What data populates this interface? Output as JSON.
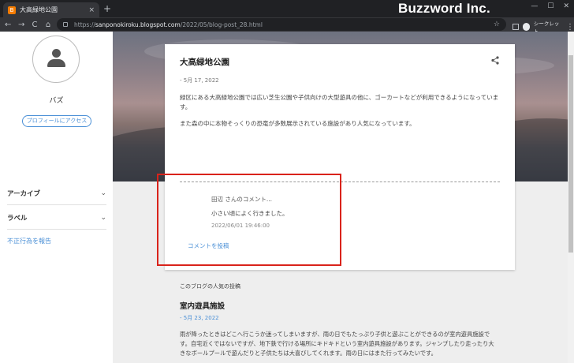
{
  "browser": {
    "tab_title": "大高緑地公園",
    "favicon_letter": "B",
    "tab_close": "×",
    "new_tab": "+",
    "brand": "Buzzword Inc.",
    "win_min": "—",
    "win_max": "☐",
    "win_close": "✕",
    "back": "←",
    "forward": "→",
    "reload": "C",
    "home": "⌂",
    "url_scheme": "https://",
    "url_host": "sanponokiroku.blogspot.com",
    "url_path": "/2022/05/blog-post_28.html",
    "star": "☆",
    "incognito_label": "シークレット",
    "menu": "⋮"
  },
  "sidebar": {
    "profile_name": "バズ",
    "profile_button": "プロフィールにアクセス",
    "archive_label": "アーカイブ",
    "labels_label": "ラベル",
    "chevron": "⌄",
    "report_link": "不正行為を報告"
  },
  "post": {
    "title": "大高緑地公園",
    "date": "- 5月 17, 2022",
    "paragraphs": [
      "緑区にある大高緑地公園では広い芝生公園や子供向けの大型遊具の他に、ゴーカートなどが利用できるようになっています。",
      "また森の中に本物そっくりの恐竜が多数展示されている施設があり人気になっています。"
    ]
  },
  "comment": {
    "author": "田辺 さんのコメント...",
    "text": "小さい頃によく行きました。",
    "time": "2022/06/01 19:46:00",
    "post_link": "コメントを投稿"
  },
  "popular": {
    "heading": "このブログの人気の投稿",
    "title": "室内遊具施設",
    "date": "- 5月 23, 2022",
    "body": "雨が降ったときはどこへ行こうか迷ってしまいますが、雨の日でもたっぷり子供と遊ぶことができるのが室内遊具施設です。自宅近くではないですが、地下鉄で行ける場所にキドキドという室内遊具施設があります。ジャンプしたり走ったり大きなボールプールで遊んだりと子供たちは大喜びしてくれます。雨の日にはまた行ってみたいです。"
  },
  "colors": {
    "accent": "#4a8fd6",
    "highlight": "#d9231b",
    "chrome": "#202124"
  }
}
